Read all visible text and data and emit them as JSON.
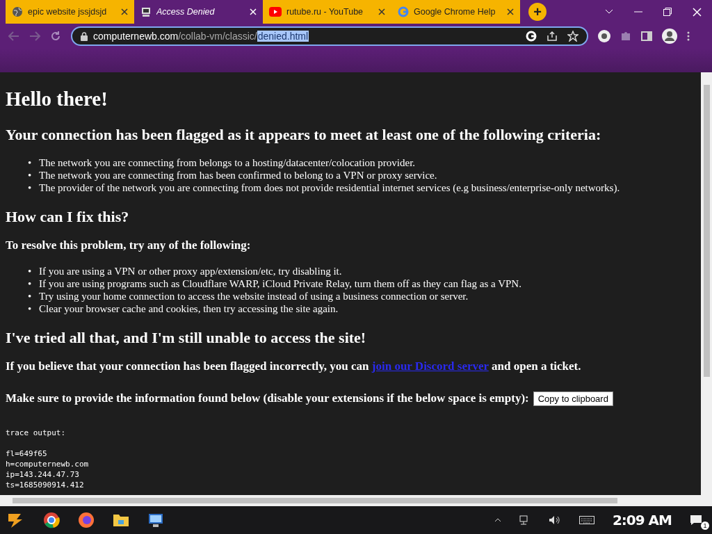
{
  "tabs": [
    {
      "title": "epic website jssjdsjd",
      "selected": false
    },
    {
      "title": "Access Denied",
      "selected": true
    },
    {
      "title": "rutube.ru - YouTube",
      "selected": false
    },
    {
      "title": "Google Chrome Help",
      "selected": false
    }
  ],
  "new_tab": "+",
  "address": {
    "domain": "computernewb.com",
    "path": "/collab-vm/classic/",
    "selected_text": "denied.html"
  },
  "page": {
    "title": "Hello there!",
    "bullet": "•",
    "criteria_heading": "Your connection has been flagged as it appears to meet at least one of the following criteria:",
    "criteria": [
      "The network you are connecting from belongs to a hosting/datacenter/colocation provider.",
      "The network you are connecting from has been confirmed to belong to a VPN or proxy service.",
      "The provider of the network you are connecting from does not provide residential internet services (e.g business/enterprise-only networks)."
    ],
    "fix_heading": "How can I fix this?",
    "fix_intro": "To resolve this problem, try any of the following:",
    "fixes": [
      "If you are using a VPN or other proxy app/extension/etc, try disabling it.",
      "If you are using programs such as Cloudflare WARP, iCloud Private Relay, turn them off as they can flag as a VPN.",
      "Try using your home connection to access the website instead of using a business connection or server.",
      "Clear your browser cache and cookies, then try accessing the site again."
    ],
    "tried_heading": "I've tried all that, and I'm still unable to access the site!",
    "contact": {
      "before": "If you believe that your connection has been flagged incorrectly, you can",
      "link": "join our Discord server",
      "after": "and open a ticket."
    },
    "provide": {
      "text": "Make sure to provide the information found below (disable your extensions if the below space is empty):",
      "button": "Copy to clipboard"
    },
    "trace": {
      "label": "trace output:",
      "lines": [
        "fl=649f65",
        "h=computernewb.com",
        "ip=143.244.47.73",
        "ts=1685090914.412"
      ]
    }
  },
  "taskbar": {
    "clock": "2:09 AM",
    "notifications": "1"
  }
}
